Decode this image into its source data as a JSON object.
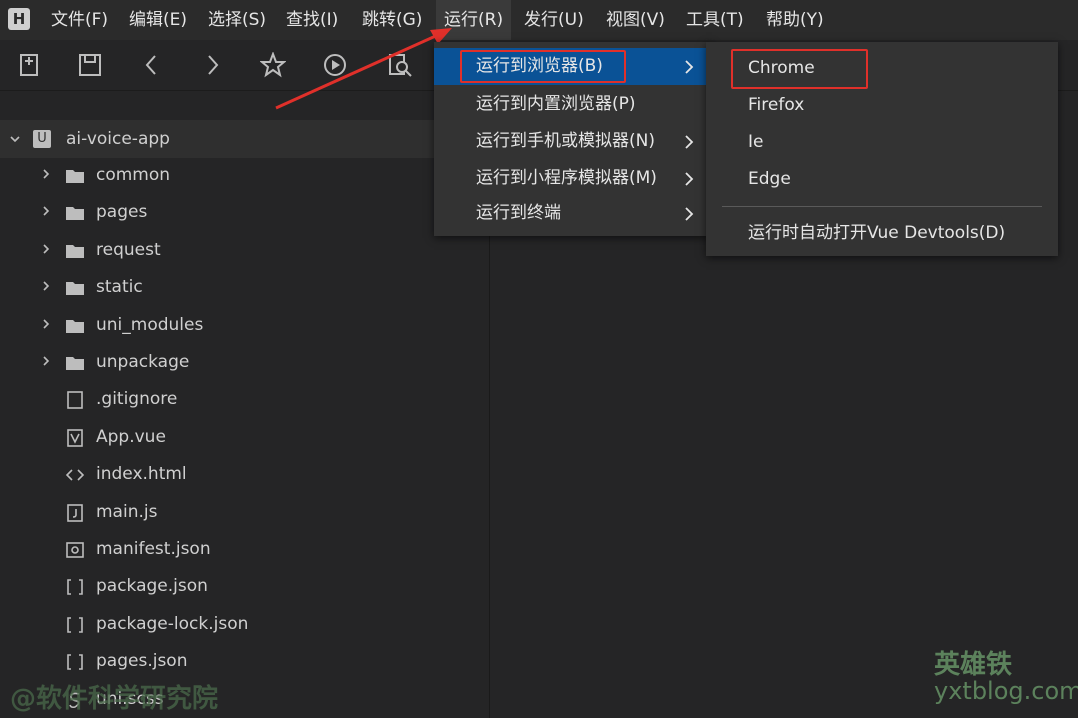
{
  "menubar": {
    "logo": "H",
    "items": [
      "文件(F)",
      "编辑(E)",
      "选择(S)",
      "查找(I)",
      "跳转(G)",
      "运行(R)",
      "发行(U)",
      "视图(V)",
      "工具(T)",
      "帮助(Y)"
    ],
    "active_index": 5
  },
  "toolbar": {
    "icons": [
      "new-file-icon",
      "save-icon",
      "back-icon",
      "forward-icon",
      "star-icon",
      "run-icon",
      "search-file-icon"
    ]
  },
  "tree": {
    "root": "ai-voice-app",
    "folders": [
      "common",
      "pages",
      "request",
      "static",
      "uni_modules",
      "unpackage"
    ],
    "files": [
      {
        "name": ".gitignore",
        "icon": "file-icon"
      },
      {
        "name": "App.vue",
        "icon": "vue-file-icon"
      },
      {
        "name": "index.html",
        "icon": "html-file-icon"
      },
      {
        "name": "main.js",
        "icon": "js-file-icon"
      },
      {
        "name": "manifest.json",
        "icon": "manifest-file-icon"
      },
      {
        "name": "package.json",
        "icon": "json-file-icon"
      },
      {
        "name": "package-lock.json",
        "icon": "json-file-icon"
      },
      {
        "name": "pages.json",
        "icon": "json-file-icon"
      },
      {
        "name": "uni.scss",
        "icon": "scss-file-icon"
      }
    ]
  },
  "run_menu": {
    "items": [
      {
        "label": "运行到浏览器(B)",
        "submenu": true,
        "selected": true
      },
      {
        "label": "运行到内置浏览器(P)",
        "submenu": false
      },
      {
        "label": "运行到手机或模拟器(N)",
        "submenu": true
      },
      {
        "label": "运行到小程序模拟器(M)",
        "submenu": true
      },
      {
        "label": "运行到终端",
        "submenu": true
      }
    ]
  },
  "browser_menu": {
    "items": [
      "Chrome",
      "Firefox",
      "Ie",
      "Edge"
    ],
    "extra": "运行时自动打开Vue Devtools(D)"
  },
  "watermarks": {
    "left": "@软件科学研究院",
    "right_brand": "英雄铁",
    "right_url": "yxtblog.com"
  },
  "colors": {
    "menu_selected": "#0a5296",
    "highlight_box": "#e0302a"
  }
}
